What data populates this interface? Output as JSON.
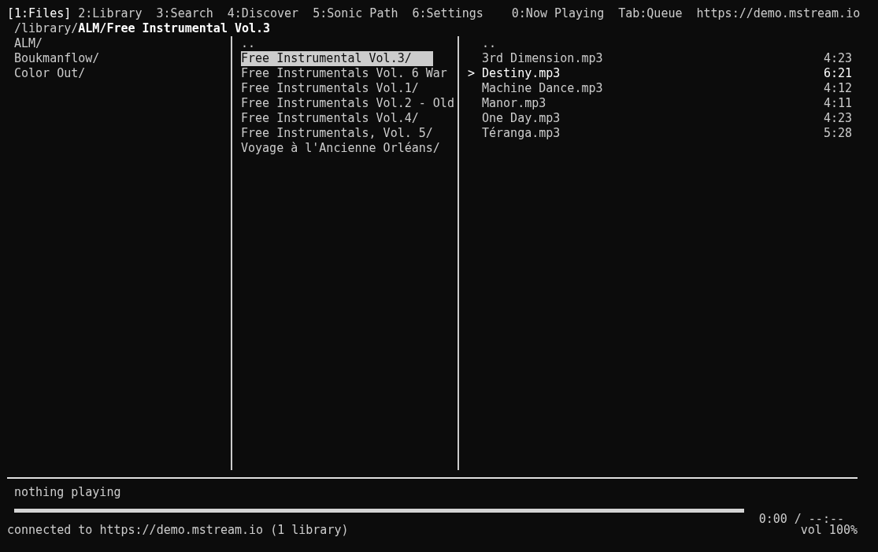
{
  "tabs": [
    {
      "label": "[1:Files]",
      "selected": true
    },
    {
      "label": "2:Library",
      "selected": false
    },
    {
      "label": "3:Search",
      "selected": false
    },
    {
      "label": "4:Discover",
      "selected": false
    },
    {
      "label": "5:Sonic Path",
      "selected": false
    },
    {
      "label": "6:Settings",
      "selected": false
    },
    {
      "label": "0:Now Playing",
      "selected": false
    },
    {
      "label": "Tab:Queue",
      "selected": false
    }
  ],
  "server": "https://demo.mstream.io",
  "path": "/library/**ALM/Free Instrumental Vol.3**",
  "left_column": [
    {
      "name": "ALM/",
      "selected": false
    },
    {
      "name": "Boukmanflow/",
      "selected": false
    },
    {
      "name": "Color Out/",
      "selected": false
    }
  ],
  "middle_column": [
    {
      "name": "..",
      "selected": false
    },
    {
      "name": "Free Instrumental Vol.3/",
      "selected": true
    },
    {
      "name": "Free Instrumentals Vol. 6 War",
      "selected": false
    },
    {
      "name": "Free Instrumentals Vol.1/",
      "selected": false
    },
    {
      "name": "Free Instrumentals Vol.2 - Old",
      "selected": false
    },
    {
      "name": "Free Instrumentals Vol.4/",
      "selected": false
    },
    {
      "name": "Free Instrumentals, Vol. 5/",
      "selected": false
    },
    {
      "name": "Voyage à l'Ancienne Orléans/",
      "selected": false
    }
  ],
  "cursor": ">",
  "right_column": [
    {
      "name": "..",
      "selected": false
    },
    {
      "name": "3rd Dimension.mp3",
      "duration": "4:23",
      "selected": false
    },
    {
      "name": "Destiny.mp3",
      "duration": "6:21",
      "selected": true
    },
    {
      "name": "Machine Dance.mp3",
      "duration": "4:12",
      "selected": false
    },
    {
      "name": "Manor.mp3",
      "duration": "4:11",
      "selected": false
    },
    {
      "name": "One Day.mp3",
      "duration": "4:23",
      "selected": false
    },
    {
      "name": "Téranga.mp3",
      "duration": "5:28",
      "selected": false
    }
  ],
  "now_playing": "nothing playing",
  "time": "0:00 / --:--",
  "status": "connected to https://demo.mstream.io (1 library)",
  "volume": "vol 100%"
}
